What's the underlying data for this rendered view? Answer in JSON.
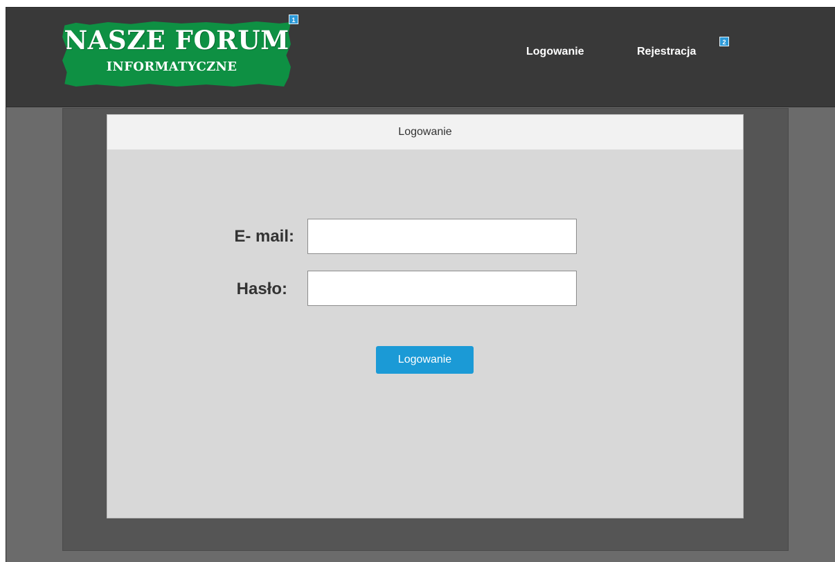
{
  "header": {
    "logo": {
      "title": "NASZE FORUM",
      "subtitle": "INFORMATYCZNE",
      "badge": "1",
      "color": "#0e9043"
    },
    "nav": {
      "login_label": "Logowanie",
      "register_label": "Rejestracja",
      "register_badge": "2"
    }
  },
  "panel": {
    "title": "Logowanie",
    "email_label": "E- mail:",
    "email_value": "",
    "password_label": "Hasło:",
    "password_value": "",
    "submit_label": "Logowanie"
  },
  "colors": {
    "header_bg": "#393939",
    "page_bg": "#6b6b6b",
    "panel_bg": "#d8d8d8",
    "button_bg": "#1b9ad6",
    "badge_bg": "#2d9ad8"
  }
}
